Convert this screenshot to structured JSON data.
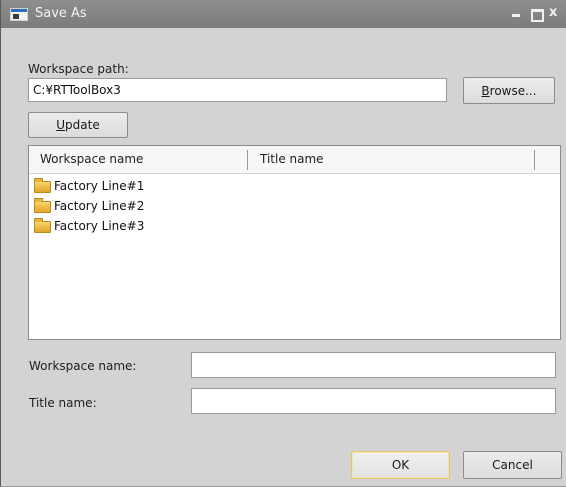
{
  "window": {
    "title": "Save As",
    "icons": {
      "app": "app-window-icon",
      "minimize": "minimize-icon",
      "maximize": "maximize-icon",
      "close": "close-icon"
    },
    "close_glyph": "x"
  },
  "workspace_path": {
    "label": "Workspace path:",
    "value": "C:¥RTToolBox3"
  },
  "buttons": {
    "browse": {
      "mnemonic": "B",
      "rest": "rowse..."
    },
    "update": {
      "mnemonic": "U",
      "rest": "pdate"
    },
    "ok": "OK",
    "cancel": "Cancel"
  },
  "list": {
    "columns": [
      "Workspace name",
      "Title name"
    ],
    "rows": [
      {
        "workspace_name": "Factory Line#1",
        "title_name": "",
        "icon": "folder-icon"
      },
      {
        "workspace_name": "Factory Line#2",
        "title_name": "",
        "icon": "folder-icon"
      },
      {
        "workspace_name": "Factory Line#3",
        "title_name": "",
        "icon": "folder-icon"
      }
    ]
  },
  "fields": {
    "workspace_name": {
      "label": "Workspace name:",
      "value": ""
    },
    "title_name": {
      "label": "Title name:",
      "value": ""
    }
  },
  "colors": {
    "titlebar": "#858585",
    "dialog_bg": "#d3d3d3",
    "ok_focus_border": "#e2c46e"
  }
}
